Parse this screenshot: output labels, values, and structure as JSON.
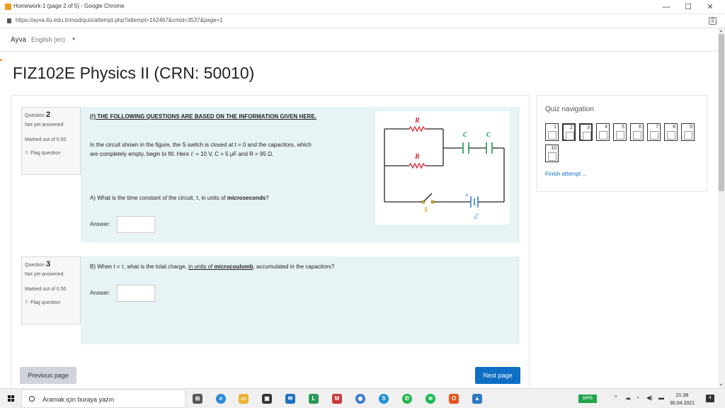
{
  "window": {
    "title": "Homework-1 (page 2 of 5) - Google Chrome",
    "minimize": "—",
    "maximize": "☐",
    "close": "✕"
  },
  "address": {
    "url": "https://ayva.itu.edu.tr/mod/quiz/attempt.php?attempt=162467&cmid=3537&page=1"
  },
  "navbar": {
    "brand": "Ayva",
    "language": "English (en)"
  },
  "course": {
    "title": "FIZ102E Physics II (CRN: 50010)"
  },
  "questions": [
    {
      "label": "Question",
      "number": "2",
      "status": "Not yet answered",
      "marked": "Marked out of 0.50",
      "flag": "Flag question"
    },
    {
      "label": "Question",
      "number": "3",
      "status": "Not yet answered",
      "marked": "Marked out of 0.50",
      "flag": "Flag question"
    }
  ],
  "q2": {
    "header": "(!) THE FOLLOWING QUESTIONS ARE BASED ON THE INFORMATION GIVEN HERE.",
    "intro_1": "In the circuit shown in the figure, the S switch is closed at t = 0 and the capacitors, which",
    "intro_2": "are completely empty, begin to fill. Here ℰ = 10 V, C = 5 μF and R = 95 Ω.",
    "part_a_prefix": "A) What is the time constant of the circuit, τ, in units of ",
    "part_a_bold": "microseconds",
    "part_a_suffix": "?",
    "answer_label": "Answer:"
  },
  "q3": {
    "part_b_prefix": "B) When t = τ, what is the total charge, ",
    "part_b_underlined": "in units of ",
    "part_b_bold": "microcoulomb",
    "part_b_suffix": ", accumulated in the capacitors?",
    "answer_label": "Answer:"
  },
  "figure": {
    "r_top": "R",
    "r_mid": "R",
    "c_left": "C",
    "c_right": "C",
    "switch": "S",
    "emf": "ℰ",
    "plus": "+"
  },
  "buttons": {
    "previous": "Previous page",
    "next": "Next page"
  },
  "quiz_nav": {
    "title": "Quiz navigation",
    "pages": [
      "1",
      "2",
      "3",
      "4",
      "5",
      "6",
      "7",
      "8",
      "9",
      "10"
    ],
    "current": [
      "2",
      "3"
    ],
    "finish": "Finish attempt ..."
  },
  "taskbar": {
    "search_placeholder": "Aramak için buraya yazın",
    "battery": "84%",
    "time": "21:38",
    "date": "30.04.2021",
    "notifications": "4"
  }
}
